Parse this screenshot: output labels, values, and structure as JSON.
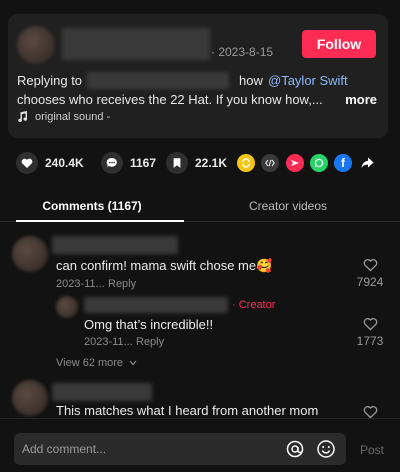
{
  "post": {
    "date": "· 2023-8-15",
    "follow_label": "Follow",
    "caption_prefix": "Replying to",
    "caption_how": "how",
    "caption_mention": "@Taylor Swift",
    "caption_line2": "chooses who receives the 22 Hat. If you know how,...",
    "more_label": "more",
    "sound_label": "original sound -"
  },
  "actions": {
    "likes": "240.4K",
    "comments": "1167",
    "saves": "22.1K"
  },
  "share_icons": [
    "repost-icon",
    "embed-icon",
    "send-icon",
    "whatsapp-icon",
    "facebook-icon",
    "share-arrow-icon"
  ],
  "colors": {
    "accent": "#fe2c55",
    "mention": "#8fb8ff",
    "background": "#121212",
    "card": "#202020"
  },
  "tabs": {
    "comments": "Comments (1167)",
    "creator": "Creator videos"
  },
  "comments": [
    {
      "text": "can confirm! mama swift chose me🥰",
      "date": "2023-11...",
      "reply_label": "Reply",
      "likes": "7924"
    },
    {
      "creator_tag": "· Creator",
      "text": "Omg that’s incredible!!",
      "date": "2023-11...",
      "reply_label": "Reply",
      "likes": "1773"
    },
    {
      "text": "This matches what I heard from another mom"
    }
  ],
  "view_more": "View 62 more",
  "input": {
    "placeholder": "Add comment...",
    "post_label": "Post"
  }
}
